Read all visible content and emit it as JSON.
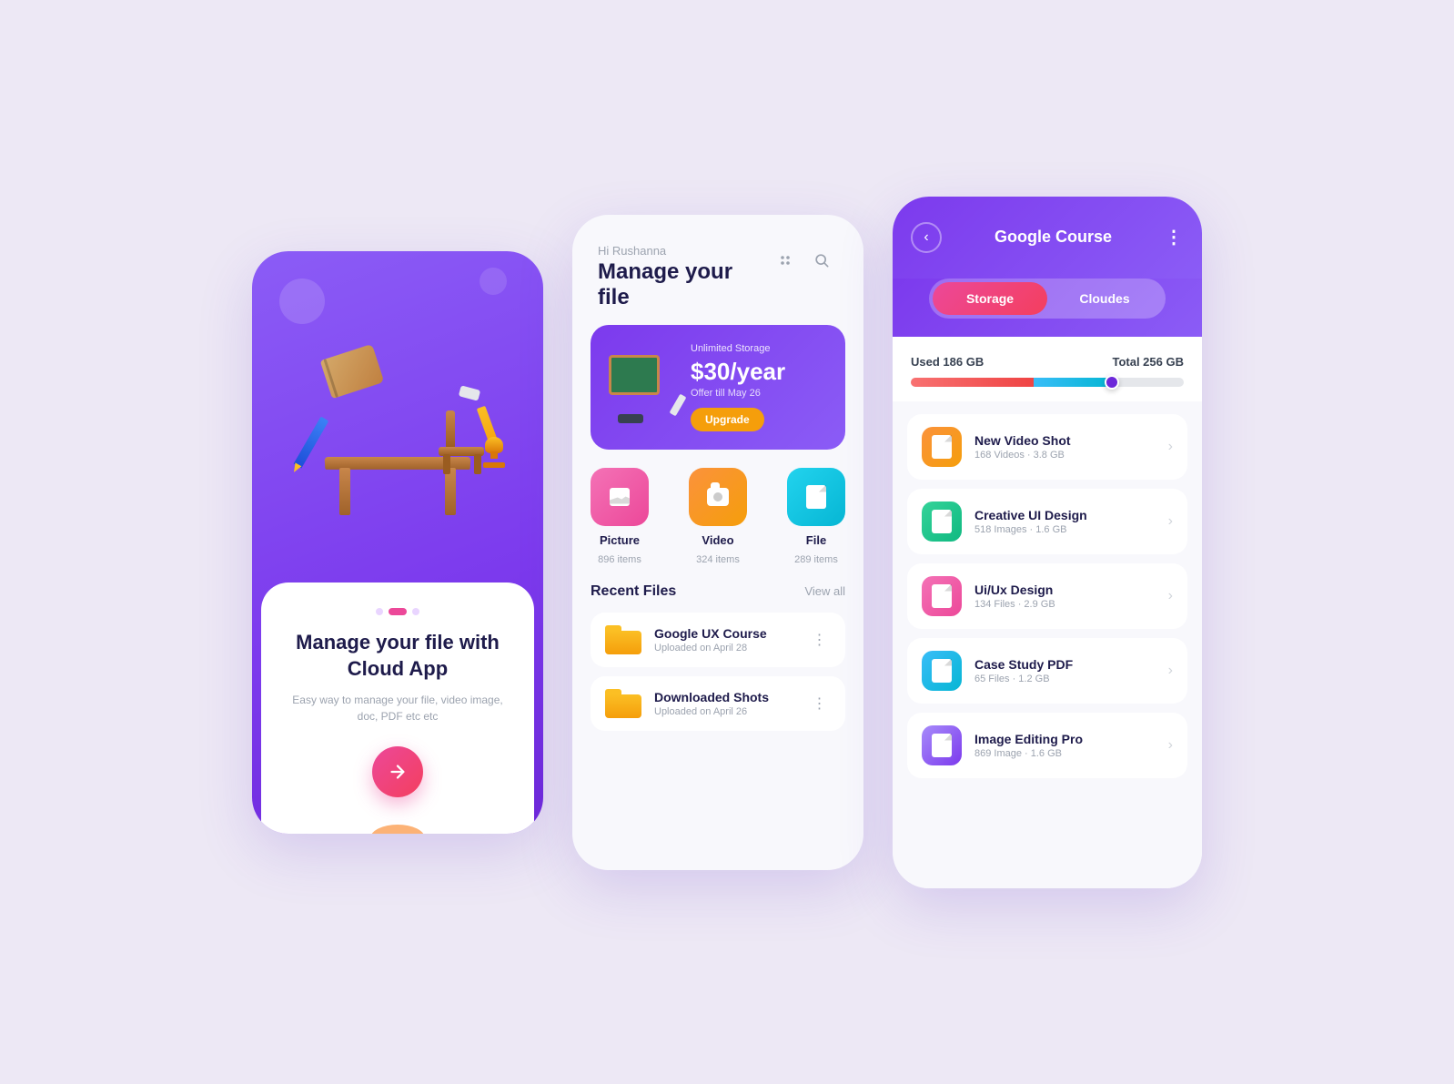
{
  "page": {
    "bg": "#ede8f5"
  },
  "phone1": {
    "title": "Manage your file with Cloud App",
    "subtitle": "Easy way to manage your file, video image, doc, PDF etc etc",
    "btn_label": "→",
    "dots": [
      "inactive",
      "active",
      "inactive"
    ]
  },
  "phone2": {
    "greeting": "Hi Rushanna",
    "title": "Manage your file",
    "promo": {
      "label": "Unlimited Storage",
      "price": "$30/year",
      "offer": "Offer till May 26",
      "btn": "Upgrade"
    },
    "categories": [
      {
        "name": "Picture",
        "count": "896 items",
        "type": "image"
      },
      {
        "name": "Video",
        "count": "324 items",
        "type": "video"
      },
      {
        "name": "File",
        "count": "289 items",
        "type": "file"
      }
    ],
    "recent_label": "Recent Files",
    "view_all": "View all",
    "files": [
      {
        "name": "Google UX Course",
        "date": "Uploaded on April 28"
      },
      {
        "name": "Downloaded Shots",
        "date": "Uploaded on April 26"
      }
    ]
  },
  "phone3": {
    "title": "Google Course",
    "back": "‹",
    "more": "⋮",
    "toggle": {
      "option1": "Storage",
      "option2": "Cloudes"
    },
    "storage": {
      "used": "Used 186 GB",
      "total": "Total 256 GB"
    },
    "files": [
      {
        "name": "New Video Shot",
        "meta": "168 Videos · 3.8 GB",
        "type": "orange"
      },
      {
        "name": "Creative UI Design",
        "meta": "518 Images · 1.6 GB",
        "type": "cyan"
      },
      {
        "name": "Ui/Ux Design",
        "meta": "134 Files · 2.9 GB",
        "type": "pink"
      },
      {
        "name": "Case Study PDF",
        "meta": "65 Files · 1.2 GB",
        "type": "blue"
      },
      {
        "name": "Image Editing Pro",
        "meta": "869 Image · 1.6 GB",
        "type": "purple"
      }
    ]
  }
}
